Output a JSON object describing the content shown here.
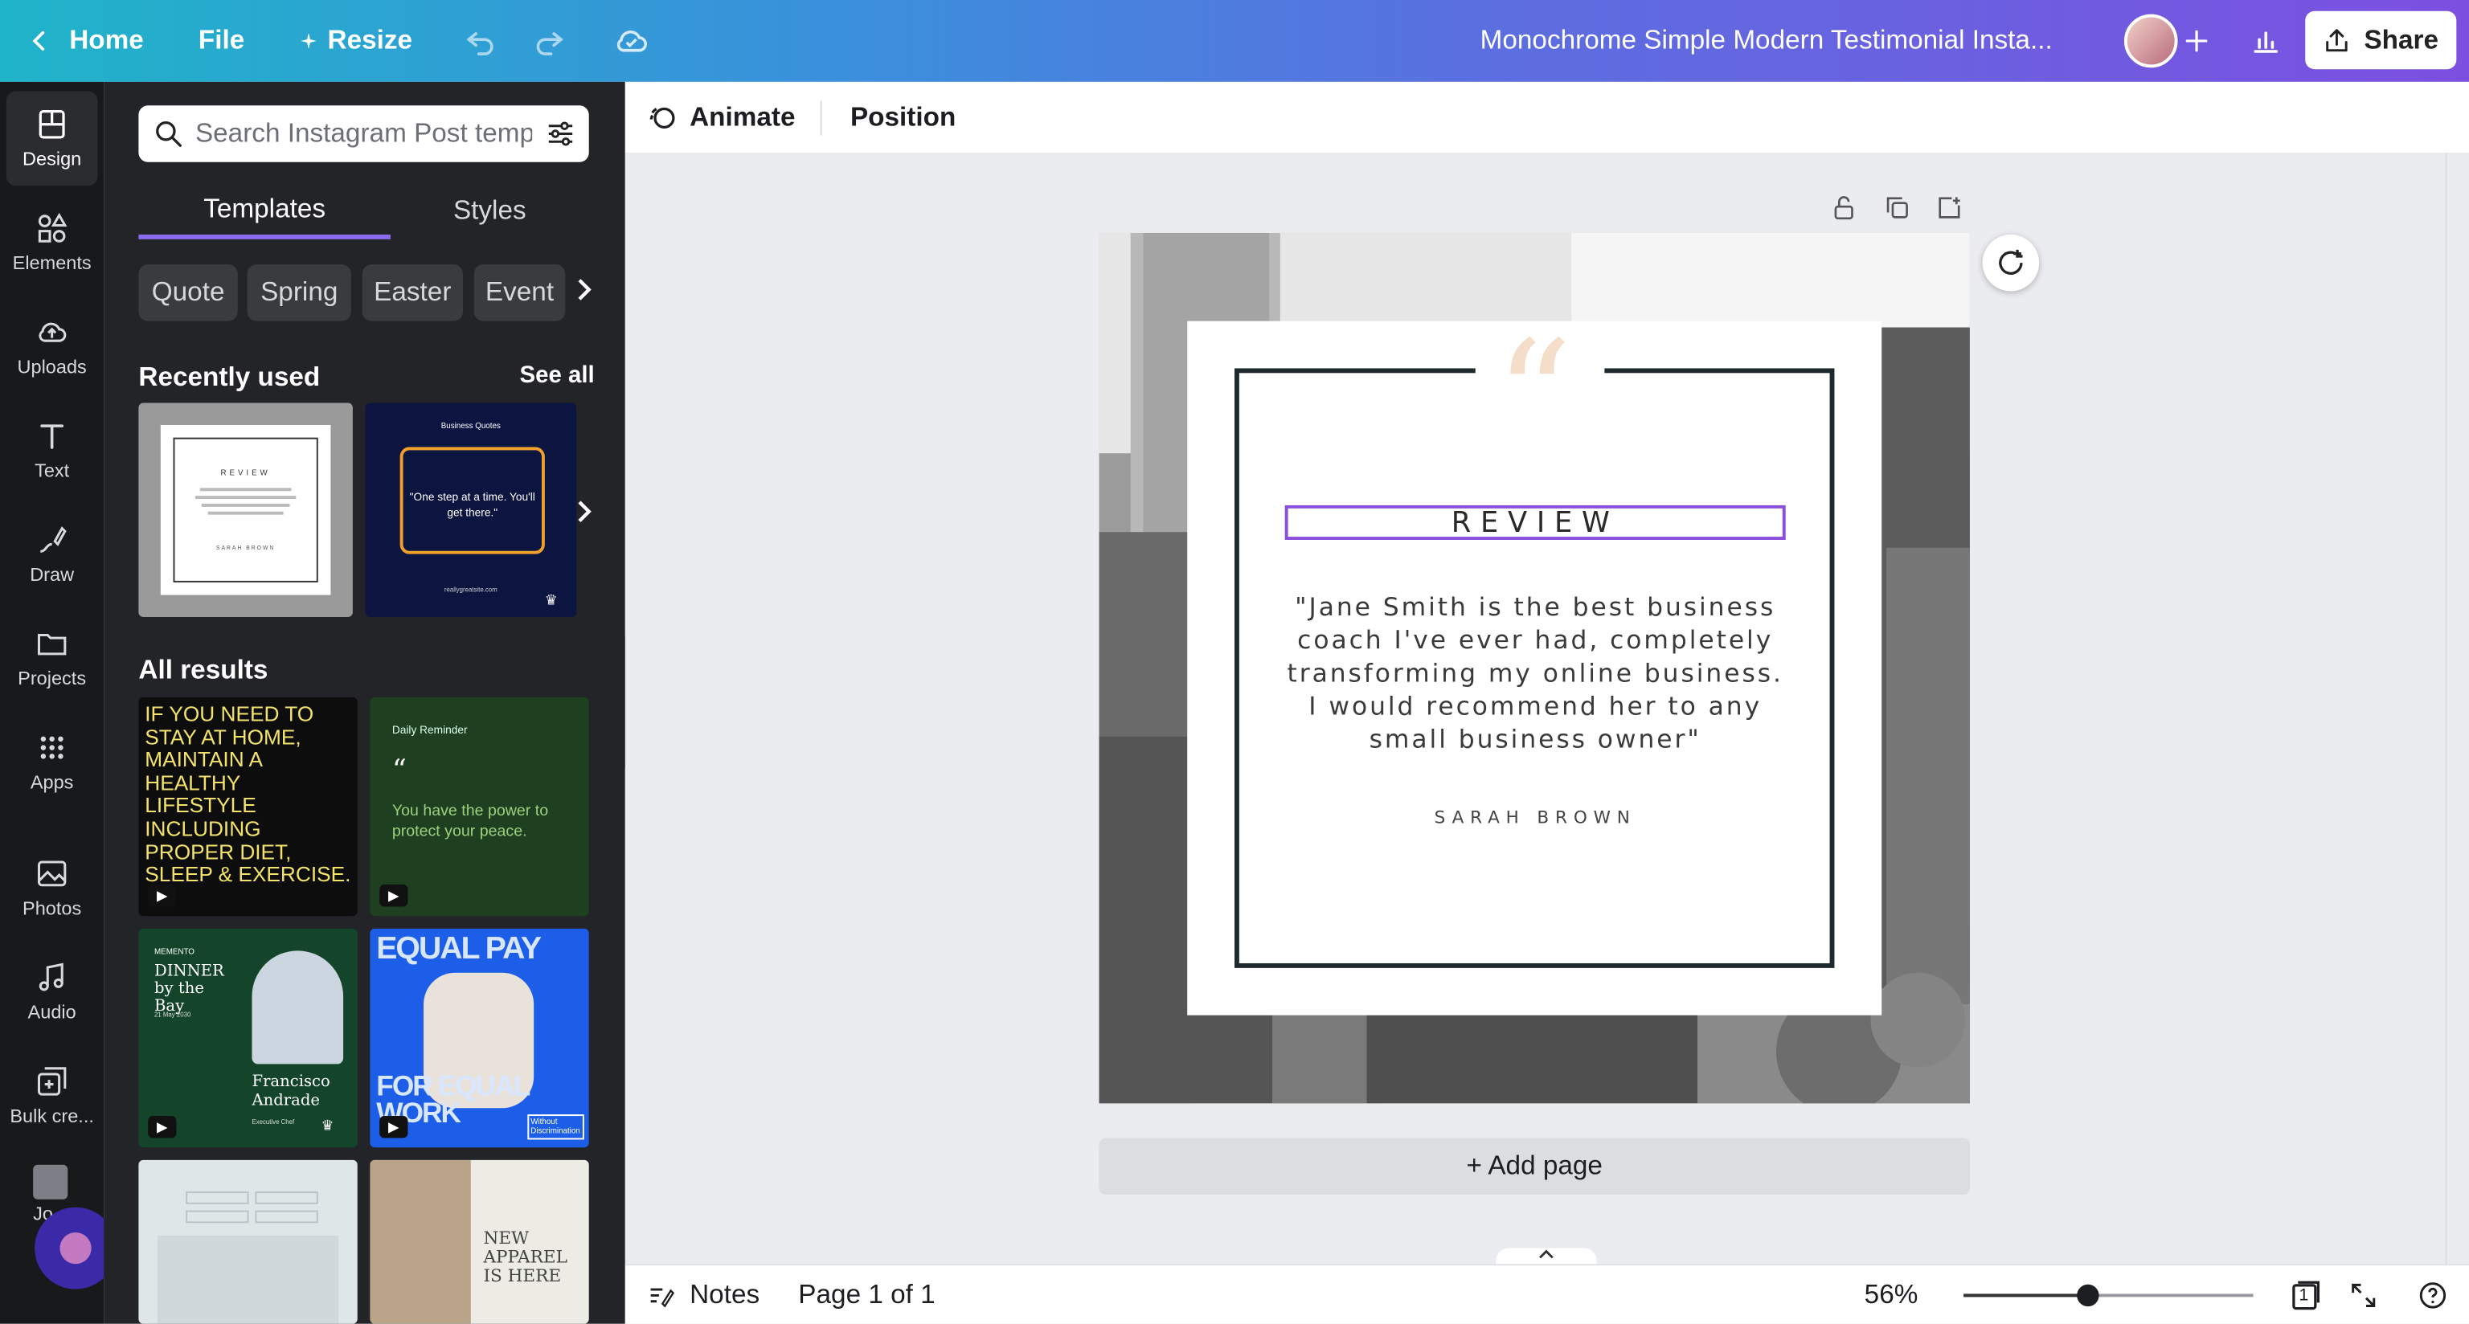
{
  "topbar": {
    "home": "Home",
    "file": "File",
    "resize": "Resize",
    "title": "Monochrome Simple Modern Testimonial Insta...",
    "share": "Share"
  },
  "rail": {
    "items": [
      {
        "label": "Design",
        "icon": "design-icon"
      },
      {
        "label": "Elements",
        "icon": "elements-icon"
      },
      {
        "label": "Uploads",
        "icon": "cloud-upload-icon"
      },
      {
        "label": "Text",
        "icon": "text-icon"
      },
      {
        "label": "Draw",
        "icon": "draw-icon"
      },
      {
        "label": "Projects",
        "icon": "folder-icon"
      },
      {
        "label": "Apps",
        "icon": "apps-grid-icon"
      },
      {
        "label": "Photos",
        "icon": "photo-icon"
      },
      {
        "label": "Audio",
        "icon": "music-note-icon"
      },
      {
        "label": "Bulk cre...",
        "icon": "bulk-create-icon"
      }
    ],
    "profile_label": "Jo"
  },
  "panel": {
    "search_placeholder": "Search Instagram Post temp",
    "tabs": [
      "Templates",
      "Styles"
    ],
    "chips": [
      "Quote",
      "Spring",
      "Easter",
      "Event"
    ],
    "recently_used": "Recently used",
    "see_all": "See all",
    "all_results": "All results",
    "thumbs": {
      "review_mini": {
        "review": "REVIEW",
        "author": "SARAH BROWN"
      },
      "business_quotes": {
        "title": "Business Quotes",
        "quote": "\"One step at a time. You'll get there.\"",
        "url": "reallygreatsite.com"
      },
      "stay_home": {
        "text": "IF YOU NEED TO STAY AT HOME, MAINTAIN A HEALTHY LIFESTYLE INCLUDING PROPER DIET, SLEEP & EXERCISE."
      },
      "daily_reminder": {
        "title": "Daily Reminder",
        "quote": "You have the power to protect your peace."
      },
      "dinner": {
        "brand": "MEMENTO",
        "title": "DINNER by the Bay",
        "date": "21 May 2030",
        "name": "Francisco Andrade",
        "role": "Executive Chef"
      },
      "equal_pay": {
        "top": "EQUAL PAY",
        "bottom": "FOR EQUAL WORK",
        "tag": "Without Discrimination"
      },
      "apparel": {
        "title": "NEW APPAREL IS HERE"
      }
    }
  },
  "context_bar": {
    "animate": "Animate",
    "position": "Position"
  },
  "design": {
    "review": "REVIEW",
    "body": "\"Jane Smith is the best business coach I've ever had, completely transforming my online business. I would recommend her to any small business owner\"",
    "author": "SARAH BROWN",
    "quote_color": "#f4ddc9",
    "frame_color": "#1f2a2f",
    "selection_color": "#8a4fdb"
  },
  "add_page": "+ Add page",
  "bottombar": {
    "notes": "Notes",
    "page_indicator": "Page 1 of 1",
    "zoom": "56%",
    "page_count_badge": "1",
    "zoom_slider_fraction": 0.43
  }
}
